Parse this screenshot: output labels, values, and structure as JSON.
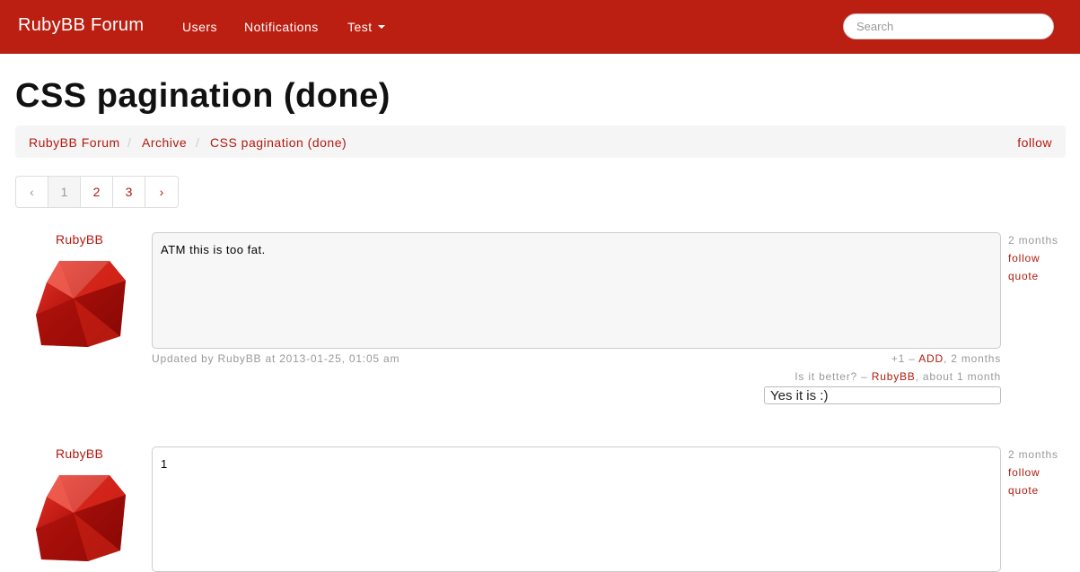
{
  "navbar": {
    "brand": "RubyBB Forum",
    "links": [
      "Users",
      "Notifications",
      "Test"
    ],
    "search_placeholder": "Search"
  },
  "page": {
    "title": "CSS pagination (done)",
    "breadcrumb": [
      "RubyBB Forum",
      "Archive",
      "CSS pagination (done)"
    ],
    "breadcrumb_separator": "/",
    "follow_label": "follow"
  },
  "pagination": {
    "prev": "‹",
    "pages": [
      "1",
      "2",
      "3"
    ],
    "next": "›",
    "active_page": "1"
  },
  "posts": [
    {
      "author": "RubyBB",
      "body": "ATM this is too fat.",
      "time": "2 months",
      "follow": "follow",
      "quote": "quote",
      "updated": "Updated by RubyBB at 2013-01-25, 01:05 am",
      "vote": {
        "prefix": "+1 –",
        "add": "ADD",
        "suffix": ", 2 months"
      },
      "comment": {
        "text": "Is it better? –",
        "author": "RubyBB",
        "suffix": ", about 1 month"
      },
      "comment_input_value": "Yes it is :)"
    },
    {
      "author": "RubyBB",
      "body": "1",
      "time": "2 months",
      "follow": "follow",
      "quote": "quote"
    }
  ],
  "colors": {
    "navbar": "#bb1f11",
    "link": "#b21a0f",
    "muted": "#999999"
  },
  "icons": {
    "avatar": "ruby-gem-icon",
    "dropdown": "caret-down-icon"
  }
}
